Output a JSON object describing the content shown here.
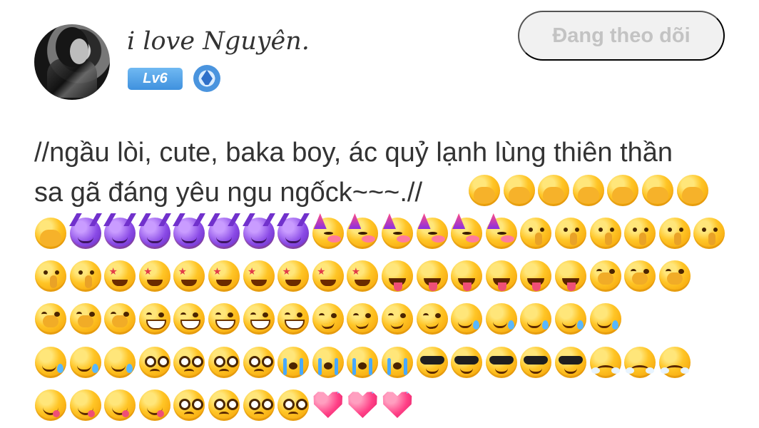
{
  "profile": {
    "username": "i love Nguyên.",
    "level_badge": "Lv6",
    "follow_button": "Đang theo dõi"
  },
  "bio": {
    "line1": "//ngầu lòi, cute, baka boy, ác quỷ lạnh lùng thiên thần",
    "line2": "sa gã đáng yêu ngu ngốck~~~.//"
  },
  "emoji_rows": [
    [
      "face-with-hand-over-eyes",
      "face-with-hand-over-eyes",
      "face-with-hand-over-eyes",
      "face-with-hand-over-eyes",
      "face-with-hand-over-eyes",
      "face-with-hand-over-eyes",
      "face-with-hand-over-eyes"
    ],
    [
      "face-with-hand-over-eyes",
      "smiling-face-with-horns",
      "smiling-face-with-horns",
      "smiling-face-with-horns",
      "smiling-face-with-horns",
      "smiling-face-with-horns",
      "smiling-face-with-horns",
      "smiling-face-with-horns",
      "partying-face",
      "partying-face",
      "partying-face",
      "partying-face",
      "partying-face",
      "partying-face",
      "shushing-face",
      "shushing-face",
      "shushing-face",
      "shushing-face",
      "shushing-face",
      "shushing-face"
    ],
    [
      "shushing-face",
      "shushing-face",
      "star-struck",
      "star-struck",
      "star-struck",
      "star-struck",
      "star-struck",
      "star-struck",
      "star-struck",
      "star-struck",
      "face-with-tongue",
      "face-with-tongue",
      "face-with-tongue",
      "face-with-tongue",
      "face-with-tongue",
      "face-with-tongue",
      "face-with-hand-over-mouth",
      "face-with-hand-over-mouth",
      "face-with-hand-over-mouth"
    ],
    [
      "face-with-hand-over-mouth",
      "face-with-hand-over-mouth",
      "face-with-hand-over-mouth",
      "grinning-face",
      "grinning-face",
      "grinning-face",
      "grinning-face",
      "grinning-face",
      "smirking-face",
      "smirking-face",
      "smirking-face",
      "smirking-face",
      "smiling-face-with-tear",
      "smiling-face-with-tear",
      "smiling-face-with-tear",
      "smiling-face-with-tear",
      "smiling-face-with-tear"
    ],
    [
      "smiling-face-with-tear",
      "smiling-face-with-tear",
      "smiling-face-with-tear",
      "pleading-face",
      "pleading-face",
      "pleading-face",
      "pleading-face",
      "loudly-crying-face",
      "loudly-crying-face",
      "loudly-crying-face",
      "loudly-crying-face",
      "smiling-face-with-sunglasses",
      "smiling-face-with-sunglasses",
      "smiling-face-with-sunglasses",
      "smiling-face-with-sunglasses",
      "smiling-face-with-sunglasses",
      "face-with-steam-from-nose",
      "face-with-steam-from-nose",
      "face-with-steam-from-nose"
    ],
    [
      "face-savoring-food",
      "face-savoring-food",
      "face-savoring-food",
      "face-savoring-food",
      "pleading-face",
      "pleading-face",
      "pleading-face",
      "pleading-face",
      "heart-with-arrow",
      "heart-with-arrow",
      "heart-with-arrow"
    ]
  ]
}
